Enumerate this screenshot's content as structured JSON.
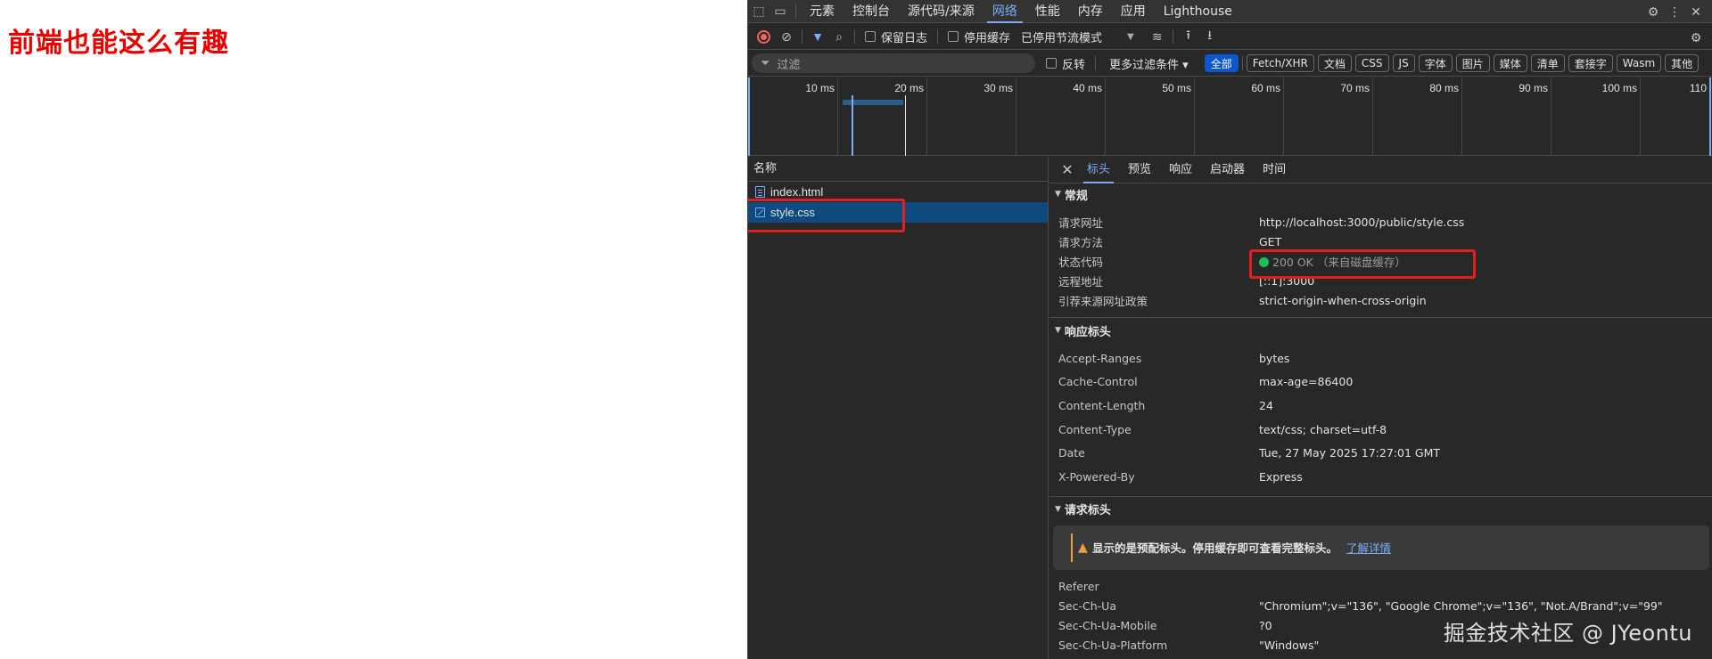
{
  "page": {
    "heading": "前端也能这么有趣"
  },
  "devtools": {
    "tabs": [
      "元素",
      "控制台",
      "源代码/来源",
      "网络",
      "性能",
      "内存",
      "应用",
      "Lighthouse"
    ],
    "toolbar": {
      "preserve_log": "保留日志",
      "disable_cache": "停用缓存",
      "throttling": "已停用节流模式"
    },
    "filter": {
      "placeholder": "过滤",
      "invert": "反转",
      "more_filters": "更多过滤条件",
      "chips": [
        "全部",
        "Fetch/XHR",
        "文档",
        "CSS",
        "JS",
        "字体",
        "图片",
        "媒体",
        "清单",
        "套接字",
        "Wasm",
        "其他"
      ]
    },
    "timeline": {
      "ticks": [
        "10 ms",
        "20 ms",
        "30 ms",
        "40 ms",
        "50 ms",
        "60 ms",
        "70 ms",
        "80 ms",
        "90 ms",
        "100 ms",
        "110"
      ]
    },
    "request_list": {
      "header": "名称",
      "items": [
        "index.html",
        "style.css"
      ],
      "selected": "style.css"
    },
    "detail": {
      "tabs": [
        "标头",
        "预览",
        "响应",
        "启动器",
        "时间"
      ],
      "general": {
        "title": "常规",
        "rows": [
          {
            "k": "请求网址",
            "v": "http://localhost:3000/public/style.css"
          },
          {
            "k": "请求方法",
            "v": "GET"
          },
          {
            "k": "状态代码",
            "v": "200 OK  （来自磁盘缓存）"
          },
          {
            "k": "远程地址",
            "v": "[::1]:3000"
          },
          {
            "k": "引荐来源网址政策",
            "v": "strict-origin-when-cross-origin"
          }
        ]
      },
      "response_headers": {
        "title": "响应标头",
        "rows": [
          {
            "k": "Accept-Ranges",
            "v": "bytes"
          },
          {
            "k": "Cache-Control",
            "v": "max-age=86400"
          },
          {
            "k": "Content-Length",
            "v": "24"
          },
          {
            "k": "Content-Type",
            "v": "text/css; charset=utf-8"
          },
          {
            "k": "Date",
            "v": "Tue, 27 May 2025 17:27:01 GMT"
          },
          {
            "k": "X-Powered-By",
            "v": "Express"
          }
        ]
      },
      "request_headers": {
        "title": "请求标头",
        "warning": "显示的是预配标头。停用缓存即可查看完整标头。",
        "warning_link": "了解详情",
        "rows": [
          {
            "k": "Referer",
            "v": ""
          },
          {
            "k": "Sec-Ch-Ua",
            "v": "\"Chromium\";v=\"136\", \"Google Chrome\";v=\"136\", \"Not.A/Brand\";v=\"99\""
          },
          {
            "k": "Sec-Ch-Ua-Mobile",
            "v": "?0"
          },
          {
            "k": "Sec-Ch-Ua-Platform",
            "v": "\"Windows\""
          }
        ]
      }
    }
  },
  "watermark": "掘金技术社区 @ JYeontu"
}
